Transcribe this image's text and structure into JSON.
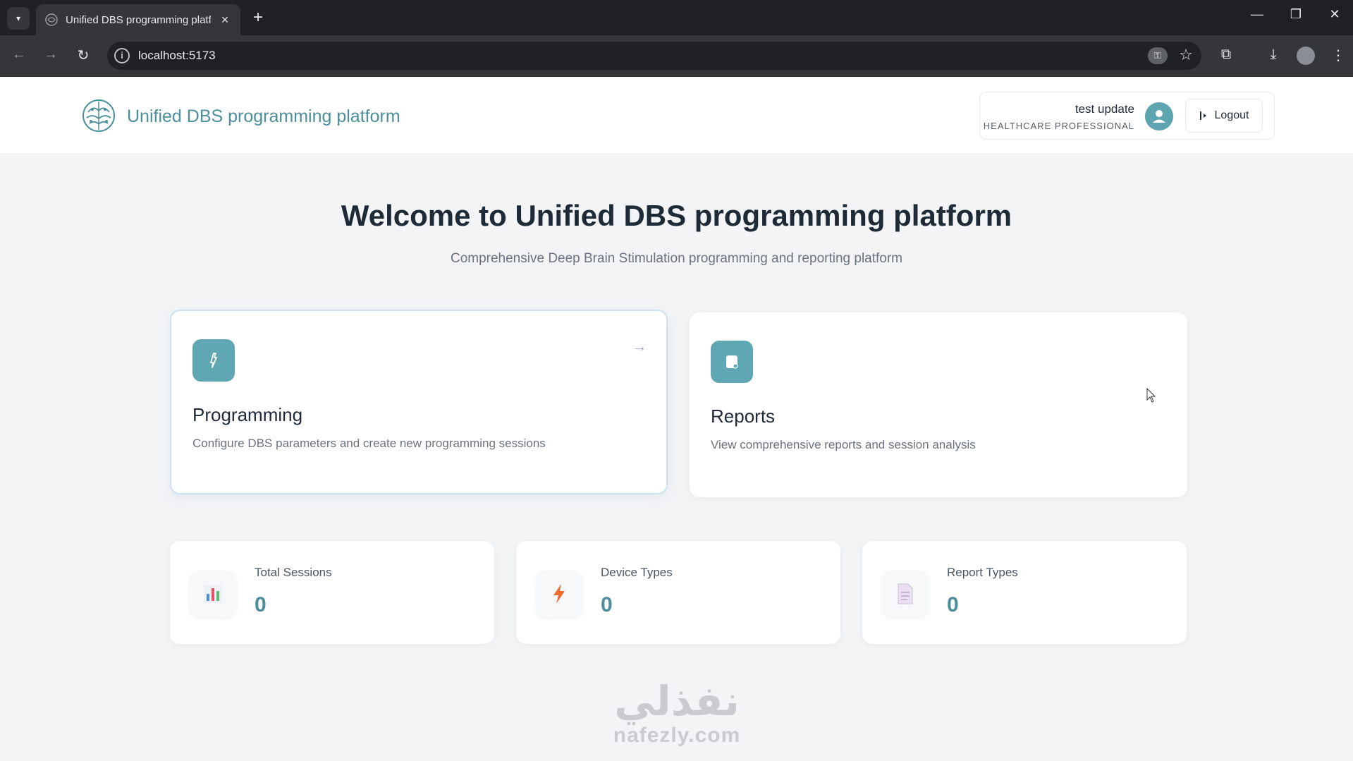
{
  "browser": {
    "tab_title": "Unified DBS programming platf",
    "url": "localhost:5173",
    "icons": [
      "tab-dropdown-icon",
      "close-icon",
      "plus-icon",
      "minimize-icon",
      "restore-icon",
      "back-icon",
      "forward-icon",
      "reload-icon",
      "info-icon",
      "key-icon",
      "star-icon",
      "extensions-icon",
      "download-icon",
      "menu-icon"
    ]
  },
  "header": {
    "brand_title": "Unified DBS programming platform",
    "user_name": "test update",
    "user_role": "HEALTHCARE PROFESSIONAL",
    "logout_label": "Logout"
  },
  "hero": {
    "title": "Welcome to Unified DBS programming platform",
    "subtitle": "Comprehensive Deep Brain Stimulation programming and reporting platform"
  },
  "features": [
    {
      "title": "Programming",
      "description": "Configure DBS parameters and create new programming sessions",
      "icon": "activity-icon"
    },
    {
      "title": "Reports",
      "description": "View comprehensive reports and session analysis",
      "icon": "document-icon"
    }
  ],
  "stats": [
    {
      "label": "Total Sessions",
      "value": "0",
      "icon": "bar-chart-icon"
    },
    {
      "label": "Device Types",
      "value": "0",
      "icon": "lightning-icon"
    },
    {
      "label": "Report Types",
      "value": "0",
      "icon": "page-icon"
    }
  ],
  "watermark": {
    "arabic": "نفذلي",
    "latin": "nafezly.com"
  },
  "colors": {
    "accent": "#4b8e9c",
    "icon_bg": "#5fa8b3",
    "page_bg": "#f3f4f6"
  }
}
